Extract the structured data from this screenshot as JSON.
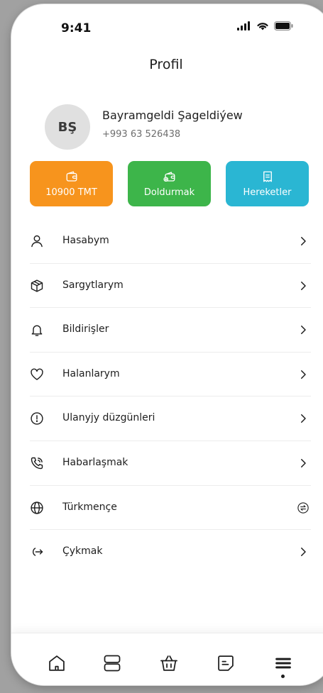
{
  "status_bar": {
    "time": "9:41"
  },
  "header": {
    "title": "Profil"
  },
  "profile": {
    "initials": "BŞ",
    "name": "Bayramgeldi Şageldiýew",
    "phone": "+993 63 526438"
  },
  "actions": [
    {
      "label": "10900 TMT",
      "icon": "wallet-icon",
      "color": "#f7941d"
    },
    {
      "label": "Doldurmak",
      "icon": "wallet-add-icon",
      "color": "#3db54a"
    },
    {
      "label": "Hereketler",
      "icon": "receipt-icon",
      "color": "#2ab6d3"
    }
  ],
  "menu": {
    "items": [
      {
        "label": "Hasabym",
        "icon": "user-icon"
      },
      {
        "label": "Sargytlarym",
        "icon": "box-icon"
      },
      {
        "label": "Bildirişler",
        "icon": "bell-icon"
      },
      {
        "label": "Halanlarym",
        "icon": "heart-icon"
      },
      {
        "label": "Ulanyjy düzgünleri",
        "icon": "info-icon"
      },
      {
        "label": "Habarlaşmak",
        "icon": "phone-call-icon"
      },
      {
        "label": "Türkmençe",
        "icon": "globe-icon"
      },
      {
        "label": "Çykmak",
        "icon": "logout-icon"
      }
    ]
  },
  "bottom_nav": {
    "tabs": [
      "home-icon",
      "categories-icon",
      "basket-icon",
      "orders-icon",
      "menu-icon"
    ],
    "active": "menu-icon"
  }
}
